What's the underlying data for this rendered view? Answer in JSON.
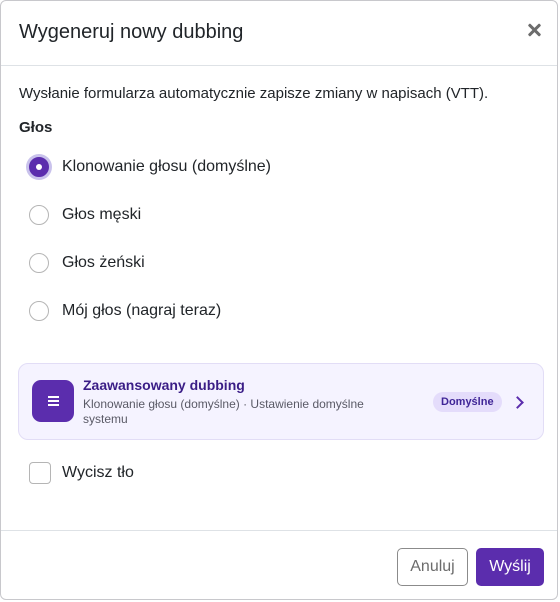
{
  "modal": {
    "title": "Wygeneruj nowy dubbing",
    "notice": "Wysłanie formularza automatycznie zapisze zmiany w napisach (VTT).",
    "voice_group_label": "Głos",
    "voice_options": [
      {
        "label": "Klonowanie głosu (domyślne)",
        "checked": true
      },
      {
        "label": "Głos męski",
        "checked": false
      },
      {
        "label": "Głos żeński",
        "checked": false
      },
      {
        "label": "Mój głos (nagraj teraz)",
        "checked": false
      }
    ],
    "advanced_card": {
      "title": "Zaawansowany dubbing",
      "subtitle": "Klonowanie głosu (domyślne) · Ustawienie domyślne systemu",
      "badge": "Domyślne",
      "icon": "list-icon"
    },
    "mute_background": {
      "label": "Wycisz tło",
      "checked": false
    },
    "cancel_label": "Anuluj",
    "submit_label": "Wyślij",
    "close_icon": "close-icon"
  },
  "colors": {
    "accent": "#5b2dad",
    "card_background": "#f5f3ff",
    "badge_background": "#e4dcfb"
  }
}
